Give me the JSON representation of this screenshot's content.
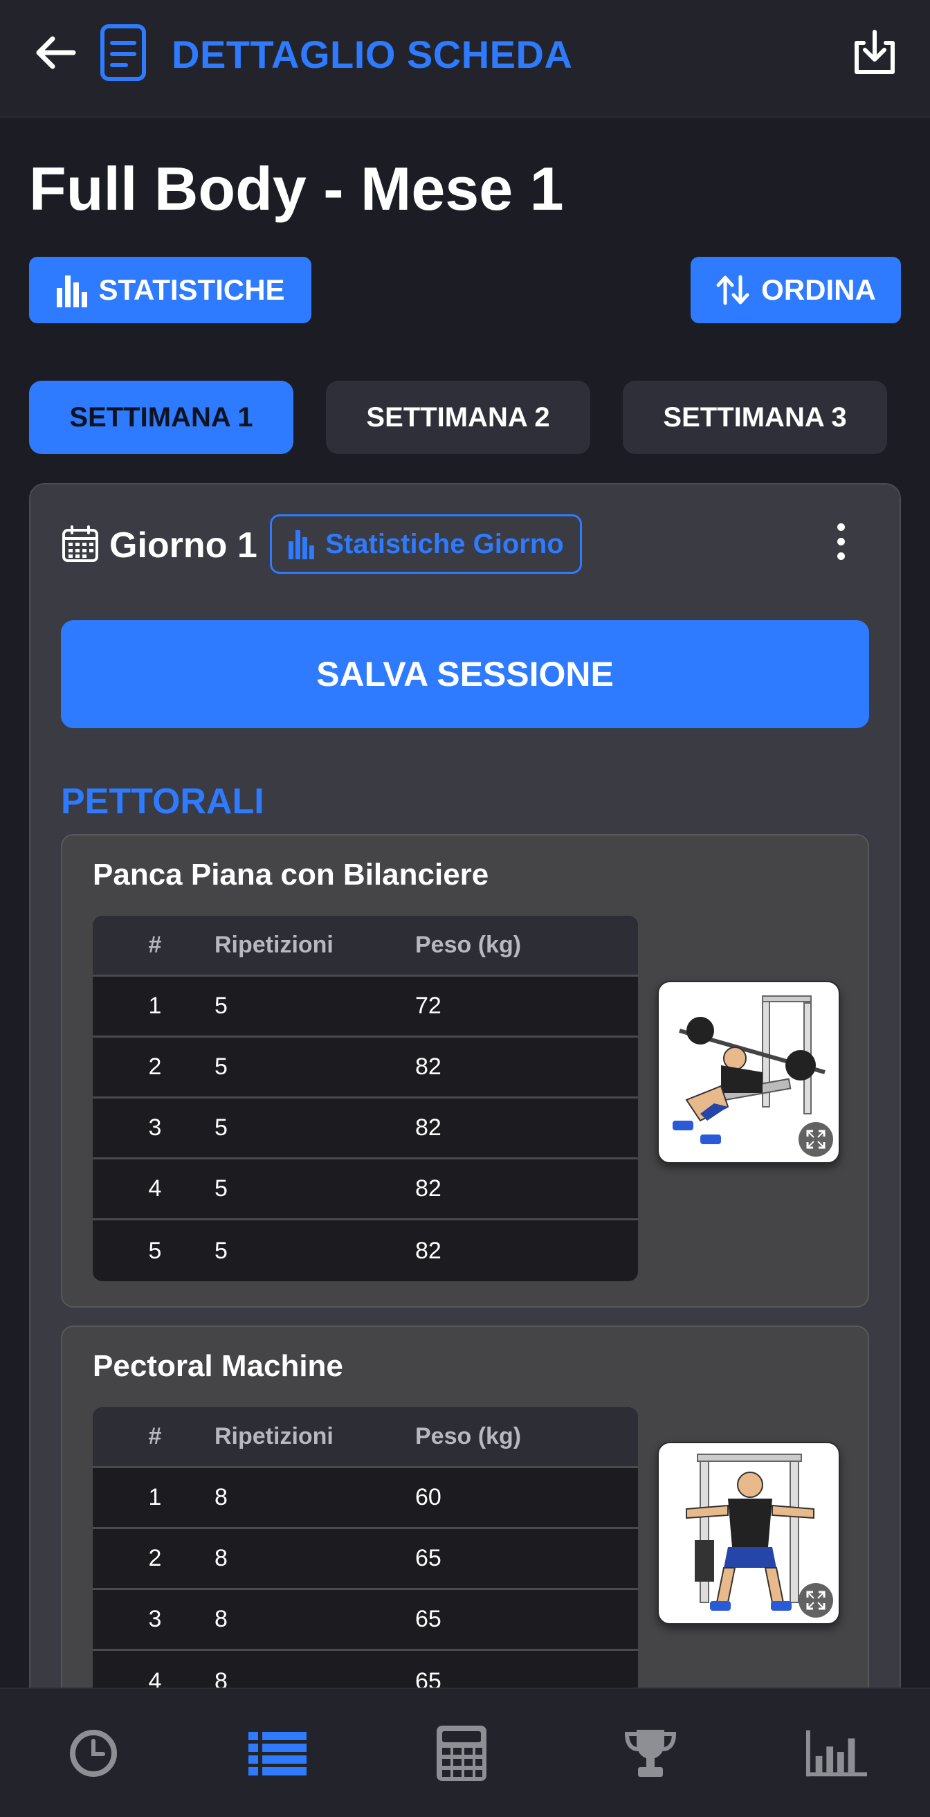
{
  "header": {
    "title": "DETTAGLIO SCHEDA",
    "back_icon": "arrow-left-icon",
    "doc_icon": "document-icon",
    "download_icon": "download-icon"
  },
  "page": {
    "title": "Full Body - Mese 1",
    "stats_button": "STATISTICHE",
    "sort_button": "ORDINA"
  },
  "weeks": {
    "tabs": [
      "SETTIMANA 1",
      "SETTIMANA 2",
      "SETTIMANA 3"
    ],
    "active": 0
  },
  "day": {
    "title": "Giorno 1",
    "stats_button": "Statistiche Giorno",
    "save_button": "SALVA SESSIONE",
    "section": "PETTORALI"
  },
  "table_headers": {
    "num": "#",
    "reps": "Ripetizioni",
    "weight": "Peso (kg)"
  },
  "exercises": [
    {
      "name": "Panca Piana con Bilanciere",
      "sets": [
        {
          "num": "1",
          "reps": "5",
          "weight": "72"
        },
        {
          "num": "2",
          "reps": "5",
          "weight": "82"
        },
        {
          "num": "3",
          "reps": "5",
          "weight": "82"
        },
        {
          "num": "4",
          "reps": "5",
          "weight": "82"
        },
        {
          "num": "5",
          "reps": "5",
          "weight": "82"
        }
      ]
    },
    {
      "name": "Pectoral Machine",
      "sets": [
        {
          "num": "1",
          "reps": "8",
          "weight": "60"
        },
        {
          "num": "2",
          "reps": "8",
          "weight": "65"
        },
        {
          "num": "3",
          "reps": "8",
          "weight": "65"
        },
        {
          "num": "4",
          "reps": "8",
          "weight": "65"
        }
      ]
    }
  ],
  "bottom_nav": [
    "clock-icon",
    "list-icon",
    "calculator-icon",
    "trophy-icon",
    "bar-chart-icon"
  ],
  "colors": {
    "accent": "#2e7bff",
    "background": "#1c1c24",
    "card": "#3a3b43"
  }
}
